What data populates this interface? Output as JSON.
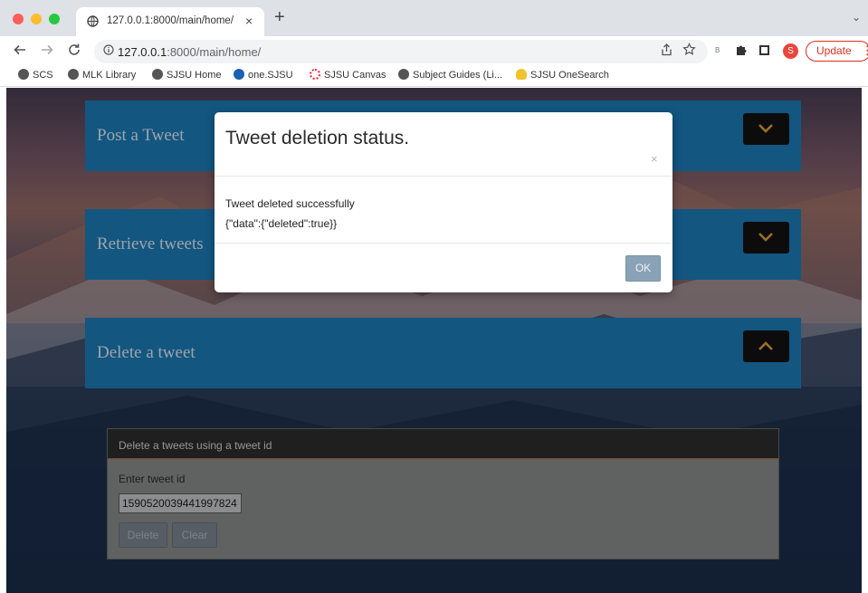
{
  "browser": {
    "tab_title": "127.0.0.1:8000/main/home/",
    "tab_close": "×",
    "new_tab": "+",
    "tab_dropdown": "⌄",
    "url_host": "127.0.0.1",
    "url_rest": ":8000/main/home/",
    "update_label": "Update",
    "avatar_letter": "S",
    "extension_letter": "B",
    "icons": {
      "back": "back-arrow-icon",
      "forward": "forward-arrow-icon",
      "reload": "reload-icon",
      "info": "info-icon",
      "share": "share-icon",
      "star": "star-icon",
      "puzzle": "extensions-icon",
      "sidepanel": "side-panel-icon",
      "menu": "kebab-menu-icon"
    },
    "colors": {
      "update": "#d93025",
      "avatar": "#e8453c"
    }
  },
  "bookmarks": [
    {
      "label": "SCS",
      "icon": "globe-icon"
    },
    {
      "label": "MLK Library",
      "icon": "globe-icon"
    },
    {
      "label": "SJSU Home",
      "icon": "globe-icon"
    },
    {
      "label": "one.SJSU",
      "icon": "sjsu-icon"
    },
    {
      "label": "SJSU Canvas",
      "icon": "canvas-icon"
    },
    {
      "label": "Subject Guides (Li...",
      "icon": "globe-icon"
    },
    {
      "label": "SJSU OneSearch",
      "icon": "lightbulb-icon"
    }
  ],
  "page": {
    "panels": [
      {
        "title": "Post a Tweet",
        "state": "collapsed"
      },
      {
        "title": "Retrieve tweets",
        "state": "collapsed"
      },
      {
        "title": "Delete a tweet",
        "state": "expanded"
      }
    ],
    "delete_card": {
      "header": "Delete a tweets using a tweet id",
      "label": "Enter tweet id",
      "input_value": "1590520039441997824",
      "delete_button": "Delete",
      "clear_button": "Clear"
    },
    "colors": {
      "panel": "#1c7fbd",
      "toggle": "#121212",
      "chevron": "#e8a33c"
    }
  },
  "modal": {
    "title": "Tweet deletion status.",
    "close": "×",
    "message": "Tweet deleted successfully",
    "response": "{\"data\":{\"deleted\":true}}",
    "ok_button": "OK"
  }
}
